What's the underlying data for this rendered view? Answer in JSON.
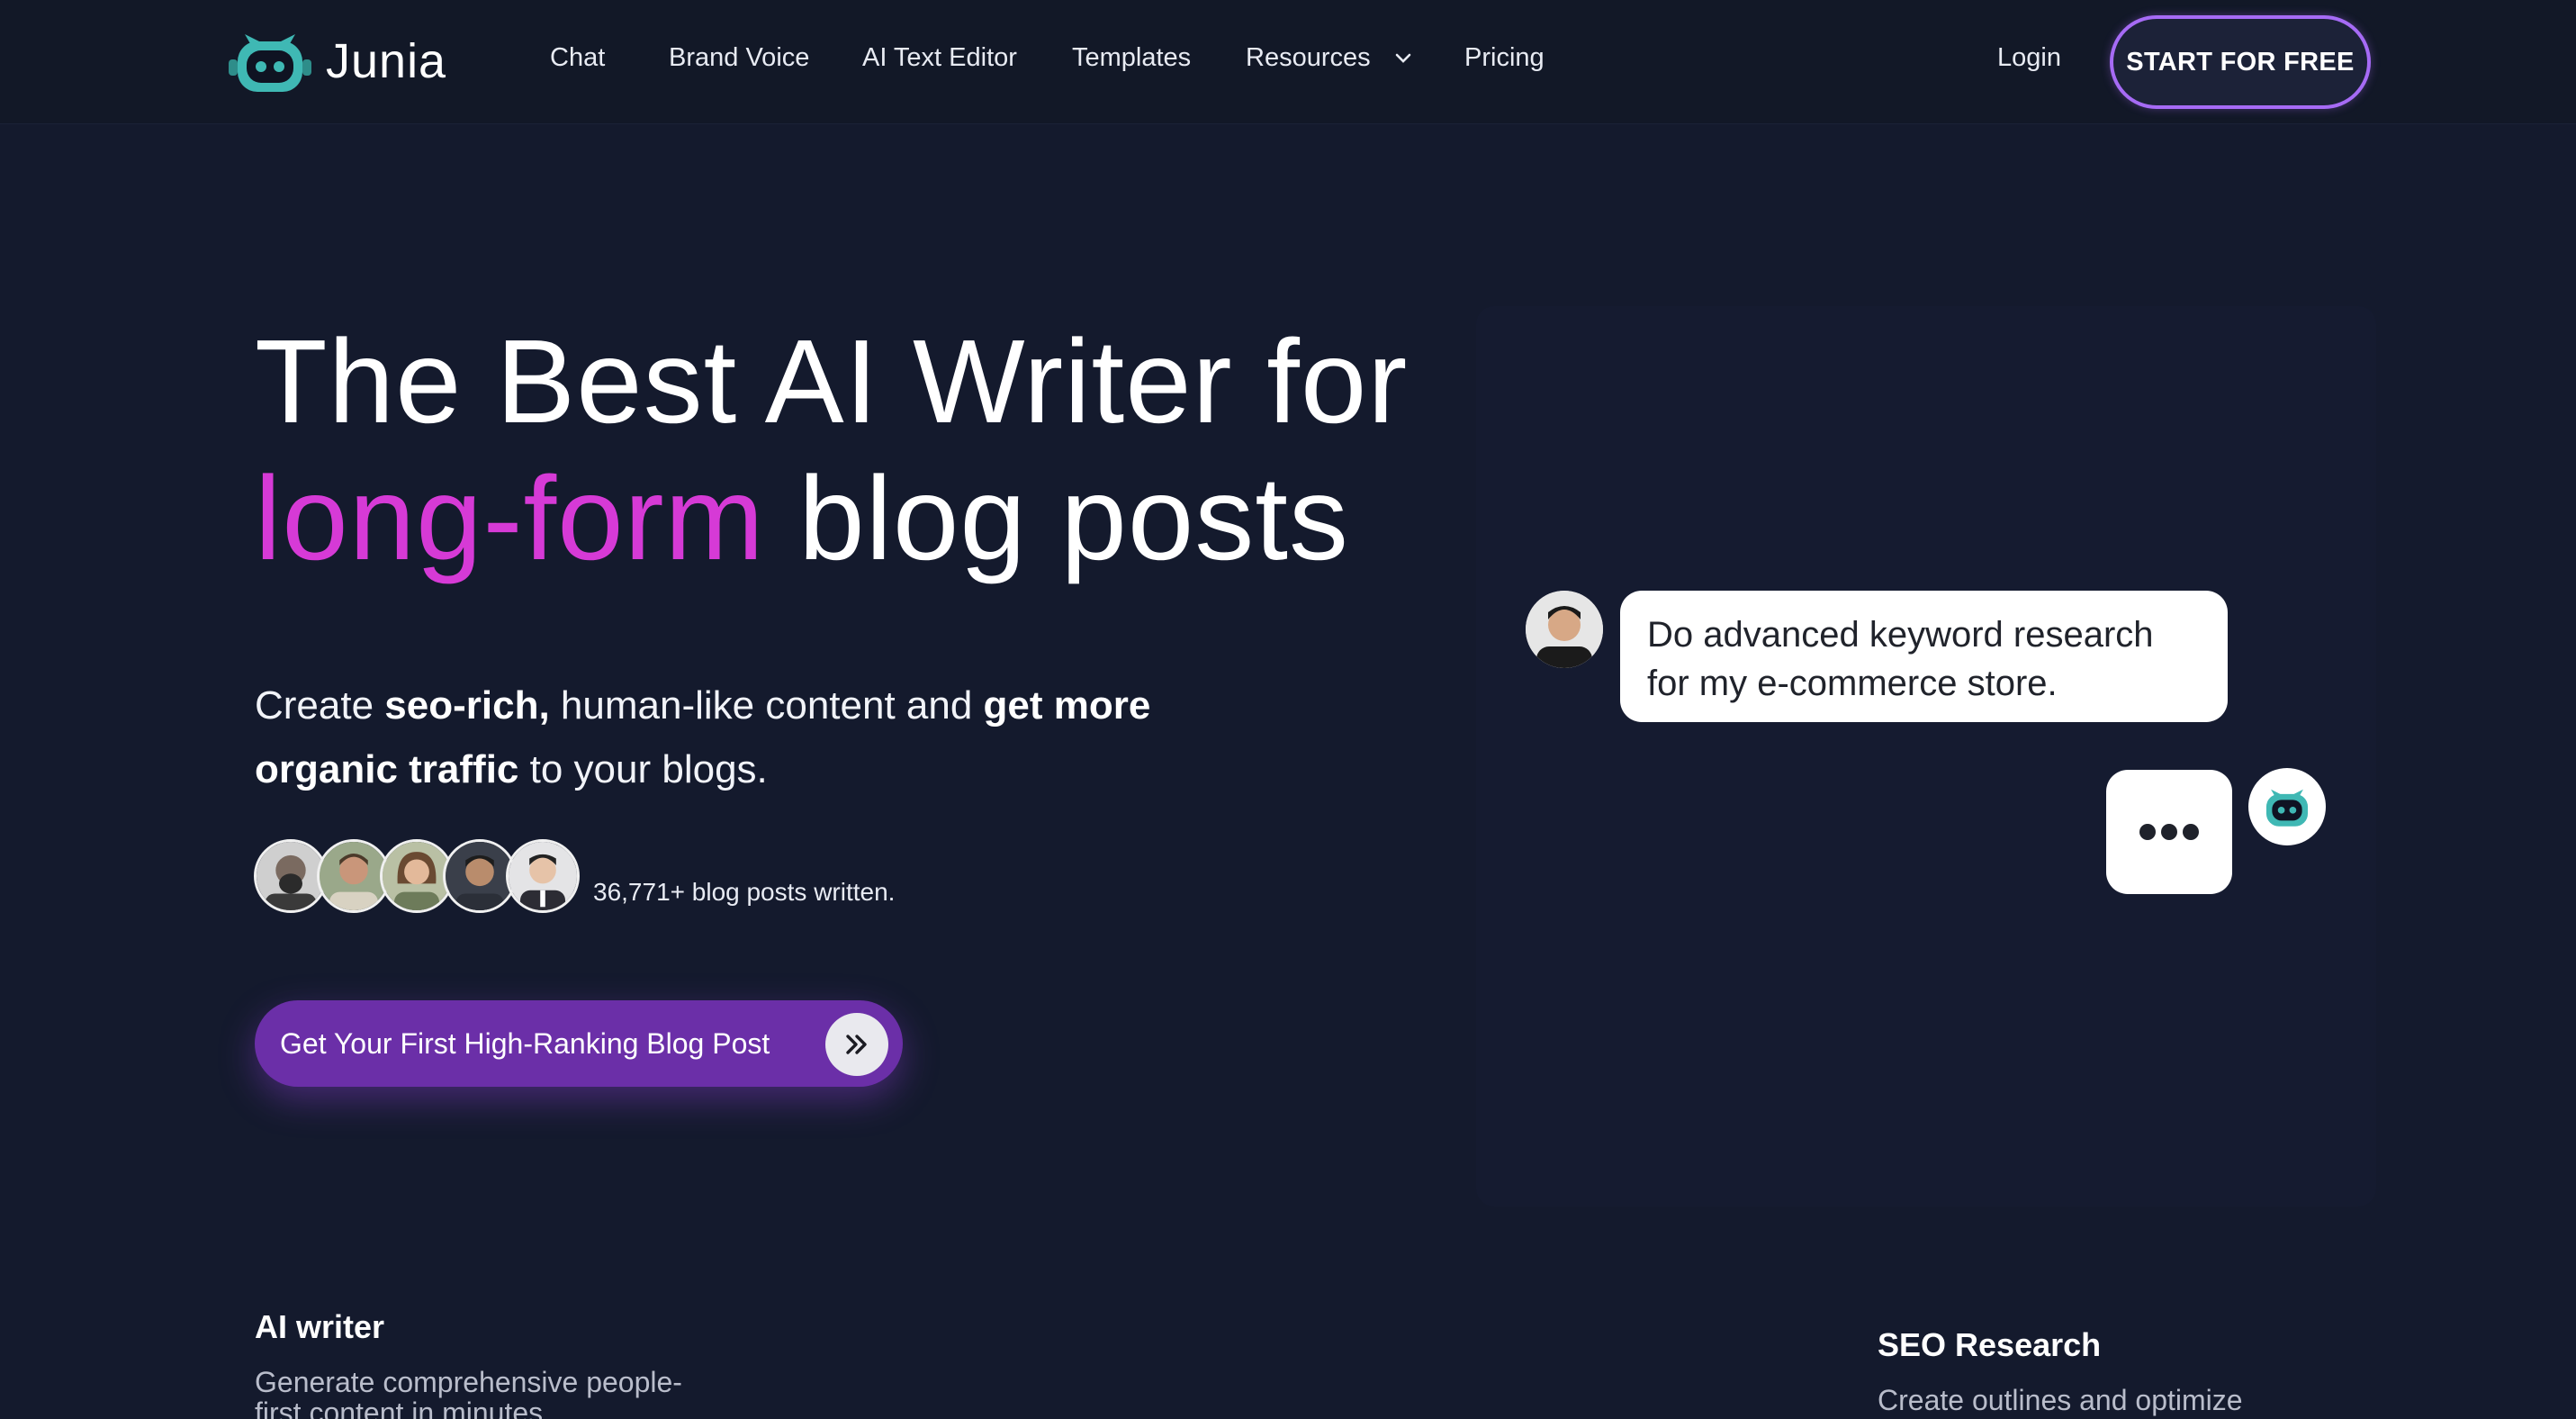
{
  "brand": {
    "name": "Junia",
    "accent_color": "#d63ad6",
    "button_color": "#6b2fa8",
    "outline_color": "#a66bf5"
  },
  "nav": {
    "links": [
      "Chat",
      "Brand Voice",
      "AI Text Editor",
      "Templates",
      "Resources",
      "Pricing"
    ],
    "login": "Login",
    "cta": "START FOR FREE"
  },
  "hero": {
    "title_line1": "The Best AI Writer for",
    "title_accent": "long-form",
    "title_rest": " blog posts",
    "sub_1": "Create ",
    "sub_2": "seo-rich,",
    "sub_3": " human-like content and ",
    "sub_4": "get more organic traffic",
    "sub_5": " to your blogs.",
    "posts_count_text": "36,771+ blog posts written.",
    "cta_label": "Get Your First High-Ranking Blog Post"
  },
  "chat": {
    "user_message": "Do advanced keyword research for my e-commerce store."
  },
  "features": [
    {
      "title": "AI writer",
      "desc": "Generate comprehensive people-first content in minutes"
    },
    {
      "title": "SEO Research",
      "desc": "Create outlines and optimize"
    }
  ]
}
